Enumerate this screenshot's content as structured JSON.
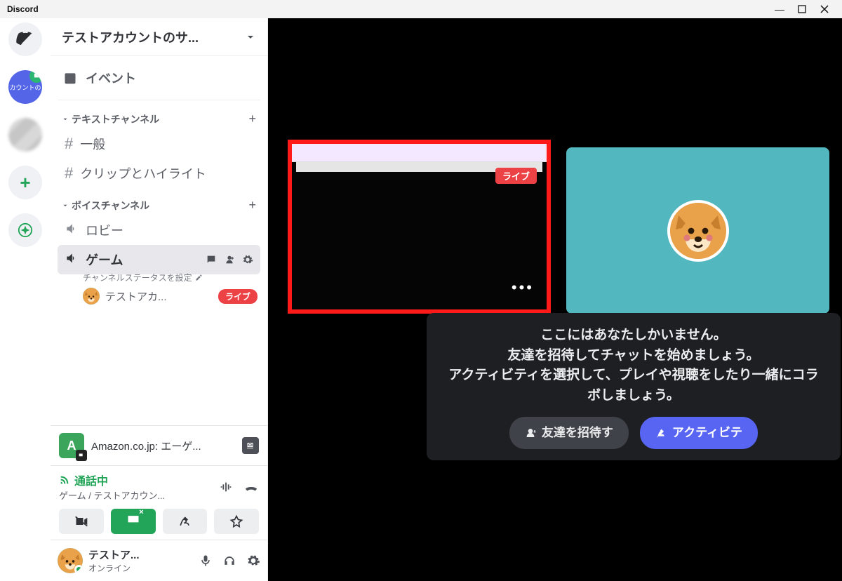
{
  "window": {
    "title": "Discord"
  },
  "rail": {
    "server1_text": "カウントの"
  },
  "server_header": {
    "name": "テストアカウントのサ..."
  },
  "events": {
    "label": "イベント"
  },
  "categories": {
    "text": {
      "label": "テキストチャンネル"
    },
    "voice": {
      "label": "ボイスチャンネル"
    }
  },
  "channels": {
    "general": "一般",
    "clips": "クリップとハイライト",
    "lobby": "ロビー",
    "game": "ゲーム",
    "game_sub": "チャンネルステータスを設定"
  },
  "vc_user": {
    "name": "テストアカ...",
    "live": "ライブ"
  },
  "activity": {
    "label": "Amazon.co.jp: エーゲ..."
  },
  "call": {
    "status": "通話中",
    "where": "ゲーム / テストアカウン..."
  },
  "user_panel": {
    "name": "テストア...",
    "status": "オンライン"
  },
  "stream_tile": {
    "live": "ライブ"
  },
  "prompt": {
    "l1": "ここにはあなたしかいません。",
    "l2": "友達を招待してチャットを始めましょう。",
    "l3": "アクティビティを選択して、プレイや視聴をしたり一緒にコラボしましょう。",
    "invite": "友達を招待す",
    "activity": "アクティビテ"
  }
}
